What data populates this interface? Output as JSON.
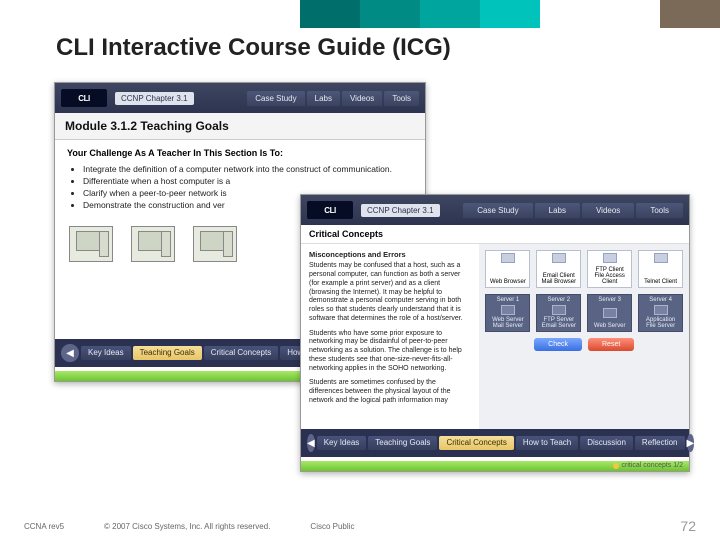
{
  "slide": {
    "title": "CLI Interactive Course Guide (ICG)",
    "footer": {
      "left": "CCNA rev5",
      "copyright": "© 2007 Cisco Systems, Inc. All rights reserved.",
      "public": "Cisco Public",
      "page": "72"
    }
  },
  "back": {
    "logo": "CLI",
    "crumb": "CCNP Chapter 3.1",
    "topTabs": [
      "Case Study",
      "Labs",
      "Videos",
      "Tools"
    ],
    "moduleHeader": "Module 3.1.2 Teaching Goals",
    "challengeHeading": "Your Challenge As A Teacher In This Section Is To:",
    "bullets": [
      "Integrate the definition of a computer network into the construct of communication.",
      "Differentiate when a host computer is a",
      "Clarify when a peer-to-peer network is",
      "Demonstrate the construction and ver"
    ],
    "bottomTabs": [
      "Key Ideas",
      "Teaching Goals",
      "Critical Concepts",
      "How to Teach"
    ],
    "activeBottomTab": 1
  },
  "front": {
    "logo": "CLI",
    "crumb": "CCNP Chapter 3.1",
    "topTabs": [
      "Case Study",
      "Labs",
      "Videos",
      "Tools"
    ],
    "ccHeader": "Critical Concepts",
    "misHeading": "Misconceptions and Errors",
    "para1": "Students may be confused that a host, such as a personal computer, can function as both a server (for example a print server) and as a client (browsing the Internet). It may be helpful to demonstrate a personal computer serving in both roles so that students clearly understand that it is software that determines the role of a host/server.",
    "para2": "Students who have some prior exposure to networking may be disdainful of peer-to-peer networking as a solution. The challenge is to help these students see that one-size-never-fits-all-networking applies in the SOHO networking.",
    "para3": "Students are sometimes confused by the differences between the physical layout of the network and the logical path information may",
    "clientCards": [
      {
        "label": "Web Browser"
      },
      {
        "label": "Email Client\nMail Browser"
      },
      {
        "label": "FTP Client\nFile Access Client"
      },
      {
        "label": "Telnet Client"
      }
    ],
    "serverCards": [
      {
        "title": "Server 1",
        "label": "Web Server\nMail Server"
      },
      {
        "title": "Server 2",
        "label": "FTP Server\nEmail Server"
      },
      {
        "title": "Server 3",
        "label": "Web Server"
      },
      {
        "title": "Server 4",
        "label": "Application\nFile Server"
      }
    ],
    "buttons": {
      "check": "Check",
      "reset": "Reset"
    },
    "bottomTabs": [
      "Key Ideas",
      "Teaching Goals",
      "Critical Concepts",
      "How to Teach",
      "Discussion",
      "Reflection"
    ],
    "activeBottomTab": 2,
    "status": "critical concepts 1/2"
  }
}
